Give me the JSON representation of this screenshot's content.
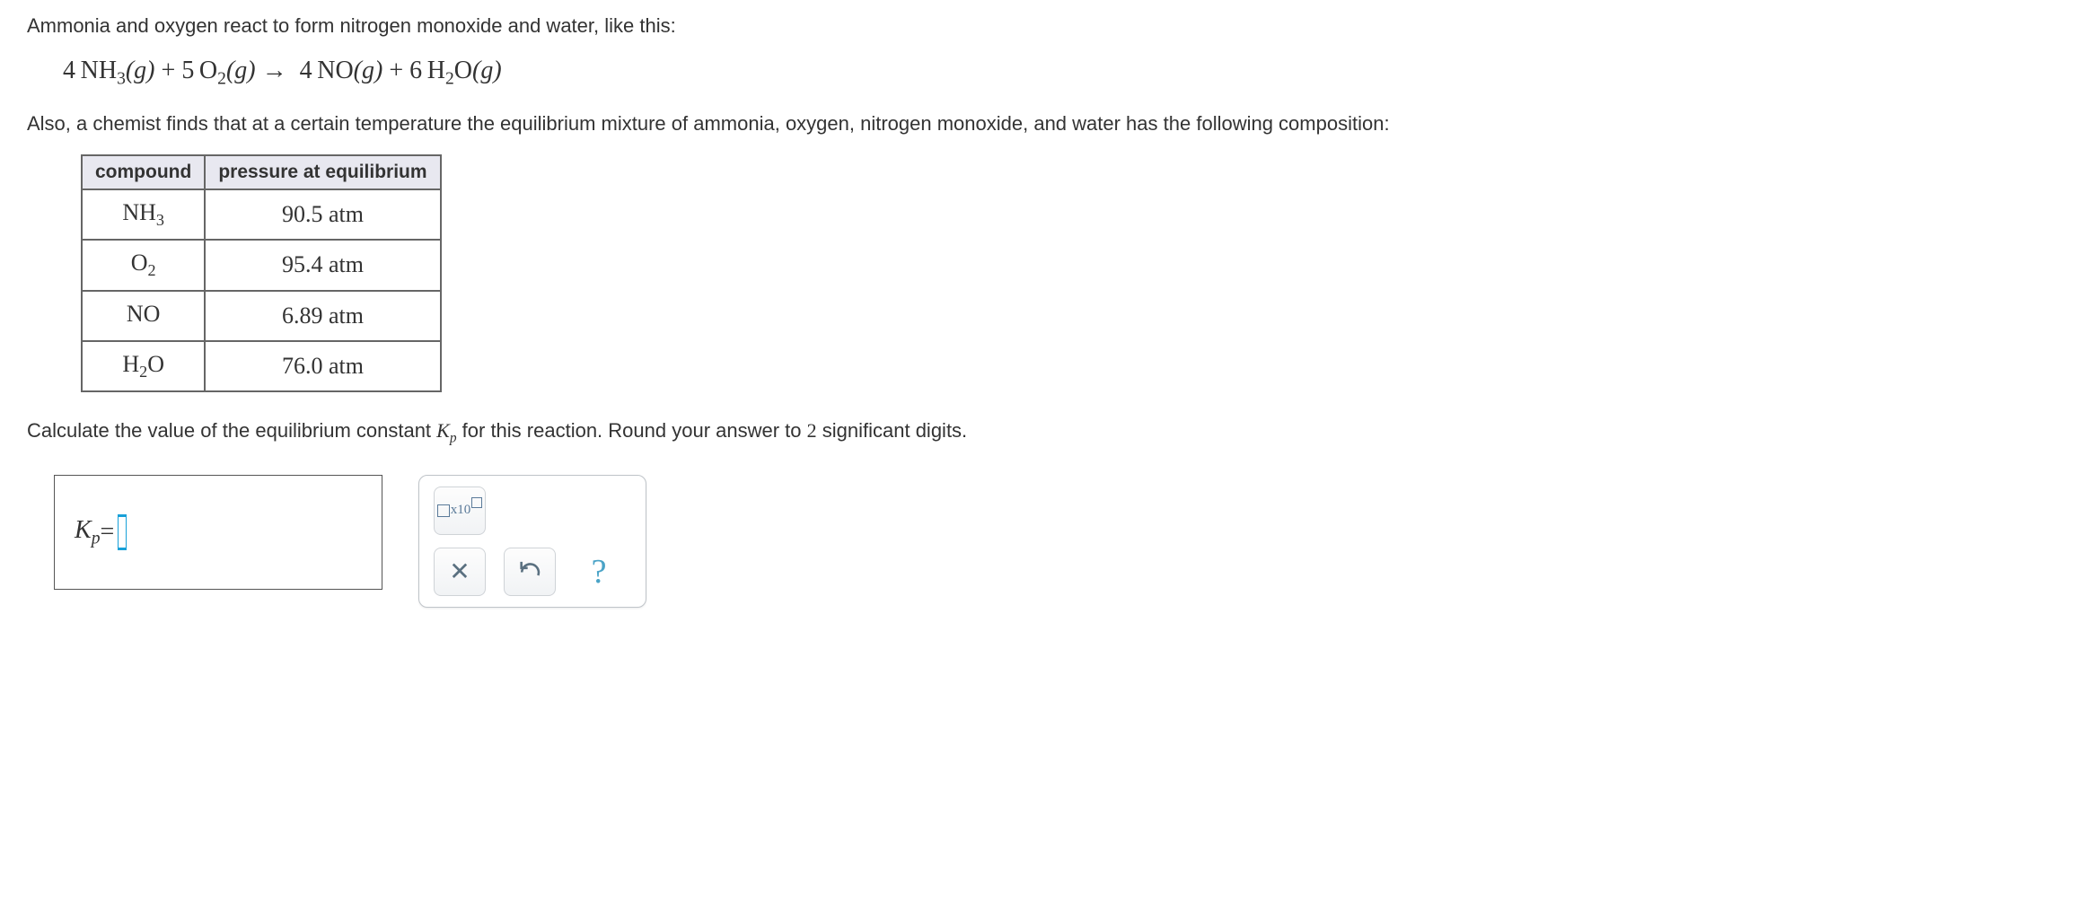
{
  "intro1": "Ammonia and oxygen react to form nitrogen monoxide and water, like this:",
  "equation": {
    "c1": "4",
    "s1": "NH",
    "sub1": "3",
    "ph1": "(g)",
    "plus1": " + ",
    "c2": "5",
    "s2": "O",
    "sub2": "2",
    "ph2": "(g)",
    "arrow": " → ",
    "c3": "4",
    "s3": "NO",
    "ph3": "(g)",
    "plus2": " + ",
    "c4": "6",
    "s4": "H",
    "sub4": "2",
    "s4b": "O",
    "ph4": "(g)"
  },
  "intro2": "Also, a chemist finds that at a certain temperature the equilibrium mixture of ammonia, oxygen, nitrogen monoxide, and water has the following composition:",
  "table": {
    "h1": "compound",
    "h2": "pressure at equilibrium",
    "rows": [
      {
        "formula_pre": "NH",
        "formula_sub": "3",
        "formula_post": "",
        "value": "90.5 atm"
      },
      {
        "formula_pre": "O",
        "formula_sub": "2",
        "formula_post": "",
        "value": "95.4 atm"
      },
      {
        "formula_pre": "NO",
        "formula_sub": "",
        "formula_post": "",
        "value": "6.89 atm"
      },
      {
        "formula_pre": "H",
        "formula_sub": "2",
        "formula_post": "O",
        "value": "76.0 atm"
      }
    ]
  },
  "question_part1": "Calculate the value of the equilibrium constant ",
  "question_kp_K": "K",
  "question_kp_p": "p",
  "question_part2": " for this reaction. Round your answer to ",
  "question_digits": "2",
  "question_part3": " significant digits.",
  "answer": {
    "K": "K",
    "p": "p",
    "eq": " = "
  },
  "tools": {
    "sci_x10": "x10"
  }
}
